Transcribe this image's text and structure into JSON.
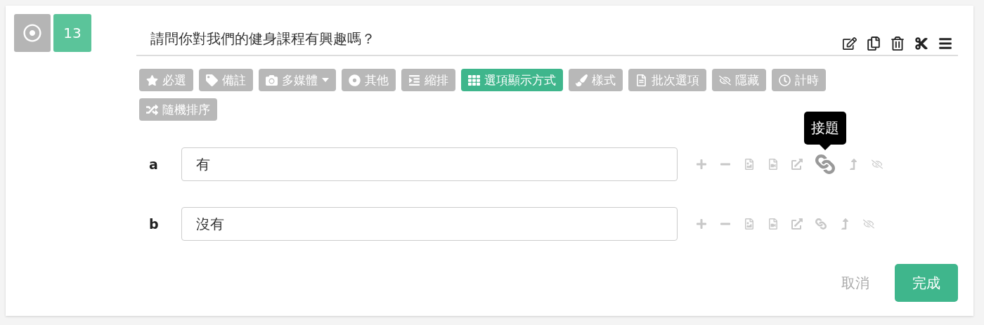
{
  "question": {
    "type_selected": true,
    "number": "13",
    "title": "請問你對我們的健身課程有興趣嗎？"
  },
  "toolbar": [
    {
      "kind": "star",
      "label": "必選",
      "selected": false
    },
    {
      "kind": "tag",
      "label": "備註",
      "selected": false
    },
    {
      "kind": "camera",
      "label": "多媒體",
      "selected": false,
      "dropdown": true
    },
    {
      "kind": "dot",
      "label": "其他",
      "selected": false
    },
    {
      "kind": "indent",
      "label": "縮排",
      "selected": false
    },
    {
      "kind": "grid",
      "label": "選項顯示方式",
      "selected": true
    },
    {
      "kind": "brush",
      "label": "樣式",
      "selected": false
    },
    {
      "kind": "file",
      "label": "批次選項",
      "selected": false
    },
    {
      "kind": "eye",
      "label": "隱藏",
      "selected": false
    },
    {
      "kind": "clock",
      "label": "計時",
      "selected": false
    },
    {
      "kind": "random",
      "label": "隨機排序",
      "selected": false
    }
  ],
  "options": [
    {
      "letter": "a",
      "value": "有",
      "link_hovered": true,
      "tooltip": "接題"
    },
    {
      "letter": "b",
      "value": "沒有",
      "link_hovered": false
    }
  ],
  "footer": {
    "cancel": "取消",
    "done": "完成"
  }
}
